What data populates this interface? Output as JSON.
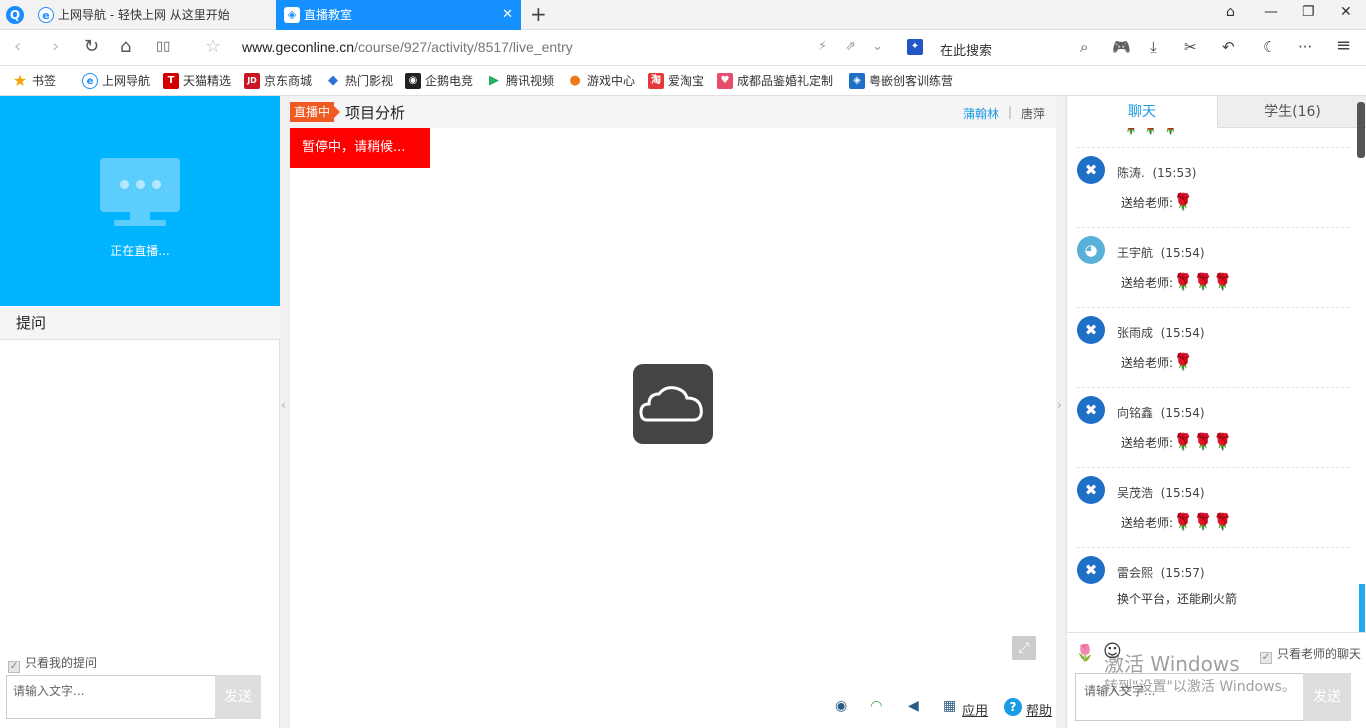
{
  "browser": {
    "logo": "Q",
    "tabs": [
      {
        "icon": "e",
        "title": "上网导航 - 轻快上网 从这里开始"
      },
      {
        "icon": "◈",
        "title": "直播教室"
      }
    ],
    "new_tab": "+",
    "window_controls": {
      "skin": "⌂",
      "minimize": "—",
      "restore": "❐",
      "close": "✕"
    }
  },
  "address_bar": {
    "back": "‹",
    "forward": "›",
    "reload": "↻",
    "home": "⌂",
    "reader": "▯▯",
    "star": "☆",
    "url_domain": "www.geconline.cn",
    "url_path": "/course/927/activity/8517/live_entry",
    "flash": "⚡",
    "share": "⇗",
    "more_down": "⌄",
    "search_engine_icon": "✦",
    "search_placeholder": "在此搜索",
    "tools": {
      "search": "⌕",
      "game": "🎮",
      "download": "⤓",
      "cut": "✂",
      "undo": "↶",
      "night": "☾",
      "more": "···",
      "menu": "≡"
    }
  },
  "bookmarks": [
    {
      "icon": "★",
      "label": "书签",
      "color": "#f5a300"
    },
    {
      "icon": "e",
      "label": "上网导航",
      "color": "#1a8cff"
    },
    {
      "icon": "T",
      "label": "天猫精选",
      "color": "#d40000"
    },
    {
      "icon": "JD",
      "label": "京东商城",
      "color": "#c81623"
    },
    {
      "icon": "◆",
      "label": "热门影视",
      "color": "#2f6fe0"
    },
    {
      "icon": "◉",
      "label": "企鹅电竞",
      "color": "#222222"
    },
    {
      "icon": "▶",
      "label": "腾讯视频",
      "color": "#20b05e"
    },
    {
      "icon": "●",
      "label": "游戏中心",
      "color": "#f07a1a"
    },
    {
      "icon": "淘",
      "label": "爱淘宝",
      "color": "#e4393c"
    },
    {
      "icon": "♥",
      "label": "成都品鉴婚礼定制",
      "color": "#e94b6a"
    },
    {
      "icon": "◈",
      "label": "粤嵌创客训练营",
      "color": "#1e6fc6"
    }
  ],
  "left_panel": {
    "live_status": "正在直播...",
    "questions_title": "提问",
    "only_mine": "只看我的提问",
    "input_placeholder": "请输入文字...",
    "send": "发送"
  },
  "center": {
    "live_badge": "直播中",
    "course_title": "项目分析",
    "teachers": [
      "蒲翰林",
      "唐萍"
    ],
    "separator": "|",
    "paused_text": "暂停中，请稍候...",
    "fullscreen_icon": "⤢",
    "controls": {
      "broadcast": "◉",
      "wifi": "◠",
      "volume": "◀",
      "apps_icon": "▦",
      "apps": "应用",
      "help_icon": "?",
      "help": "帮助"
    }
  },
  "right_panel": {
    "tabs": [
      "聊天",
      "学生(16)"
    ],
    "messages": [
      {
        "avatar": "✖",
        "name": "陈涛.",
        "time": "(15:53)",
        "prefix": "送给老师:",
        "text": "",
        "roses": 1
      },
      {
        "avatar": "◕",
        "name": "王宇航",
        "time": "(15:54)",
        "prefix": "送给老师:",
        "text": "",
        "roses": 3
      },
      {
        "avatar": "✖",
        "name": "张雨成",
        "time": "(15:54)",
        "prefix": "送给老师:",
        "text": "",
        "roses": 1
      },
      {
        "avatar": "✖",
        "name": "向铭鑫",
        "time": "(15:54)",
        "prefix": "送给老师:",
        "text": "",
        "roses": 3
      },
      {
        "avatar": "✖",
        "name": "吴茂浩",
        "time": "(15:54)",
        "prefix": "送给老师:",
        "text": "",
        "roses": 3
      },
      {
        "avatar": "✖",
        "name": "雷会熙",
        "time": "(15:57)",
        "prefix": "",
        "text": "换个平台，还能刷火箭",
        "roses": 0
      }
    ],
    "rose_glyph": "🌹",
    "flower_icon": "🌷",
    "emoji_icon": "☺",
    "teacher_only": "只看老师的聊天",
    "input_placeholder": "请输入文字...",
    "send": "发送"
  },
  "watermark": {
    "line1": "激活 Windows",
    "line2": "转到\"设置\"以激活 Windows。"
  }
}
